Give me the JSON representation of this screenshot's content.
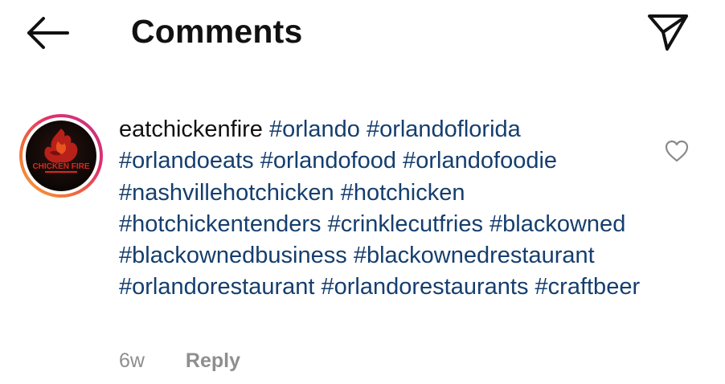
{
  "header": {
    "back_icon": "arrow-left-icon",
    "title": "Comments",
    "send_icon": "paper-plane-icon"
  },
  "comment": {
    "avatar_text": "CHICKEN FIRE",
    "username": "eatchickenfire",
    "hashtags": [
      "#orlando",
      "#orlandoflorida",
      "#orlandoeats",
      "#orlandofood",
      "#orlandofoodie",
      "#nashvillehotchicken",
      "#hotchicken",
      "#hotchickentenders",
      "#crinklecutfries",
      "#blackowned",
      "#blackownedbusiness",
      "#blackownedrestaurant",
      "#orlandorestaurant",
      "#orlandorestaurants",
      "#craftbeer"
    ],
    "timestamp": "6w",
    "reply_label": "Reply",
    "like_icon": "heart-outline-icon"
  },
  "colors": {
    "hashtag": "#153e6e",
    "meta": "#8e8e8e",
    "text": "#111111",
    "ring_start": "#f9a33b",
    "ring_end": "#c13584"
  }
}
